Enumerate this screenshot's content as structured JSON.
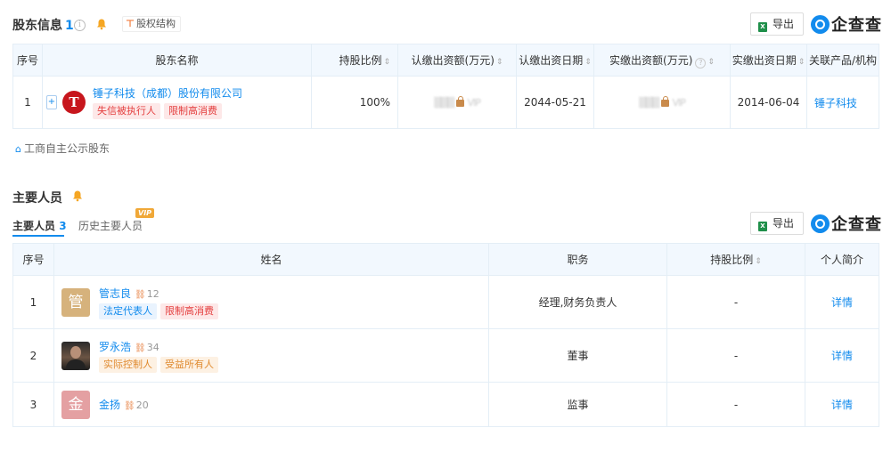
{
  "shareholders": {
    "title": "股东信息",
    "count": "1",
    "info_icon": "i",
    "structure_link": "股权结构",
    "structure_icon": "structure-icon",
    "export_label": "导出",
    "logo_text": "企查查",
    "columns": [
      "序号",
      "股东名称",
      "持股比例",
      "认缴出资额(万元)",
      "认缴出资日期",
      "实缴出资额(万元)",
      "实缴出资日期",
      "关联产品/机构"
    ],
    "rows": [
      {
        "index": "1",
        "expand": "+",
        "logo_letter": "T",
        "name": "锤子科技（成都）股份有限公司",
        "tags": [
          "失信被执行人",
          "限制高消费"
        ],
        "ratio": "100%",
        "subscribed_amount_masked": "VIP",
        "subscribed_date": "2044-05-21",
        "paid_amount_masked": "VIP",
        "paid_date": "2014-06-04",
        "related": "锤子科技"
      }
    ],
    "public_link": "工商自主公示股东"
  },
  "personnel": {
    "title": "主要人员",
    "tabs": [
      {
        "label": "主要人员",
        "count": "3"
      },
      {
        "label": "历史主要人员",
        "vip": "VIP"
      }
    ],
    "export_label": "导出",
    "logo_text": "企查查",
    "columns": [
      "序号",
      "姓名",
      "职务",
      "持股比例",
      "个人简介"
    ],
    "rows": [
      {
        "index": "1",
        "avatar_char": "管",
        "avatar_color": "#d6b27c",
        "name": "管志良",
        "relations": "12",
        "tags": [
          {
            "text": "法定代表人",
            "style": "blue"
          },
          {
            "text": "限制高消费",
            "style": "red"
          }
        ],
        "position": "经理,财务负责人",
        "ratio": "-",
        "detail": "详情"
      },
      {
        "index": "2",
        "avatar_char": "",
        "avatar_color": "photo",
        "name": "罗永浩",
        "relations": "34",
        "tags": [
          {
            "text": "实际控制人",
            "style": "orange"
          },
          {
            "text": "受益所有人",
            "style": "orange"
          }
        ],
        "position": "董事",
        "ratio": "-",
        "detail": "详情"
      },
      {
        "index": "3",
        "avatar_char": "金",
        "avatar_color": "#e4a0a2",
        "name": "金扬",
        "relations": "20",
        "tags": [],
        "position": "监事",
        "ratio": "-",
        "detail": "详情"
      }
    ]
  },
  "colors": {
    "link": "#128bed",
    "header_bg": "#f2f8fe",
    "red_tag": "#e43f3f",
    "vip": "#f0a838"
  }
}
